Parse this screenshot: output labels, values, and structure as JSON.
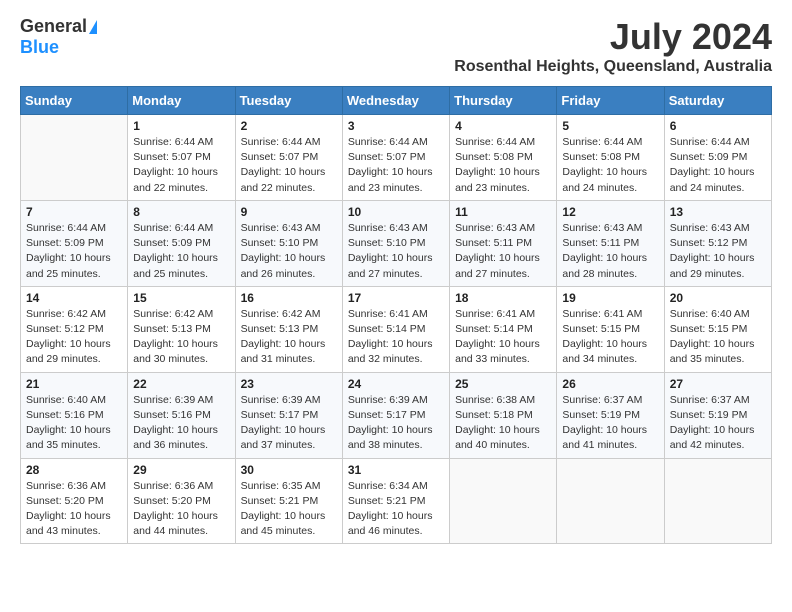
{
  "header": {
    "logo_general": "General",
    "logo_blue": "Blue",
    "month_title": "July 2024",
    "location": "Rosenthal Heights, Queensland, Australia"
  },
  "calendar": {
    "days_of_week": [
      "Sunday",
      "Monday",
      "Tuesday",
      "Wednesday",
      "Thursday",
      "Friday",
      "Saturday"
    ],
    "weeks": [
      [
        {
          "day": "",
          "info": ""
        },
        {
          "day": "1",
          "info": "Sunrise: 6:44 AM\nSunset: 5:07 PM\nDaylight: 10 hours\nand 22 minutes."
        },
        {
          "day": "2",
          "info": "Sunrise: 6:44 AM\nSunset: 5:07 PM\nDaylight: 10 hours\nand 22 minutes."
        },
        {
          "day": "3",
          "info": "Sunrise: 6:44 AM\nSunset: 5:07 PM\nDaylight: 10 hours\nand 23 minutes."
        },
        {
          "day": "4",
          "info": "Sunrise: 6:44 AM\nSunset: 5:08 PM\nDaylight: 10 hours\nand 23 minutes."
        },
        {
          "day": "5",
          "info": "Sunrise: 6:44 AM\nSunset: 5:08 PM\nDaylight: 10 hours\nand 24 minutes."
        },
        {
          "day": "6",
          "info": "Sunrise: 6:44 AM\nSunset: 5:09 PM\nDaylight: 10 hours\nand 24 minutes."
        }
      ],
      [
        {
          "day": "7",
          "info": "Sunrise: 6:44 AM\nSunset: 5:09 PM\nDaylight: 10 hours\nand 25 minutes."
        },
        {
          "day": "8",
          "info": "Sunrise: 6:44 AM\nSunset: 5:09 PM\nDaylight: 10 hours\nand 25 minutes."
        },
        {
          "day": "9",
          "info": "Sunrise: 6:43 AM\nSunset: 5:10 PM\nDaylight: 10 hours\nand 26 minutes."
        },
        {
          "day": "10",
          "info": "Sunrise: 6:43 AM\nSunset: 5:10 PM\nDaylight: 10 hours\nand 27 minutes."
        },
        {
          "day": "11",
          "info": "Sunrise: 6:43 AM\nSunset: 5:11 PM\nDaylight: 10 hours\nand 27 minutes."
        },
        {
          "day": "12",
          "info": "Sunrise: 6:43 AM\nSunset: 5:11 PM\nDaylight: 10 hours\nand 28 minutes."
        },
        {
          "day": "13",
          "info": "Sunrise: 6:43 AM\nSunset: 5:12 PM\nDaylight: 10 hours\nand 29 minutes."
        }
      ],
      [
        {
          "day": "14",
          "info": "Sunrise: 6:42 AM\nSunset: 5:12 PM\nDaylight: 10 hours\nand 29 minutes."
        },
        {
          "day": "15",
          "info": "Sunrise: 6:42 AM\nSunset: 5:13 PM\nDaylight: 10 hours\nand 30 minutes."
        },
        {
          "day": "16",
          "info": "Sunrise: 6:42 AM\nSunset: 5:13 PM\nDaylight: 10 hours\nand 31 minutes."
        },
        {
          "day": "17",
          "info": "Sunrise: 6:41 AM\nSunset: 5:14 PM\nDaylight: 10 hours\nand 32 minutes."
        },
        {
          "day": "18",
          "info": "Sunrise: 6:41 AM\nSunset: 5:14 PM\nDaylight: 10 hours\nand 33 minutes."
        },
        {
          "day": "19",
          "info": "Sunrise: 6:41 AM\nSunset: 5:15 PM\nDaylight: 10 hours\nand 34 minutes."
        },
        {
          "day": "20",
          "info": "Sunrise: 6:40 AM\nSunset: 5:15 PM\nDaylight: 10 hours\nand 35 minutes."
        }
      ],
      [
        {
          "day": "21",
          "info": "Sunrise: 6:40 AM\nSunset: 5:16 PM\nDaylight: 10 hours\nand 35 minutes."
        },
        {
          "day": "22",
          "info": "Sunrise: 6:39 AM\nSunset: 5:16 PM\nDaylight: 10 hours\nand 36 minutes."
        },
        {
          "day": "23",
          "info": "Sunrise: 6:39 AM\nSunset: 5:17 PM\nDaylight: 10 hours\nand 37 minutes."
        },
        {
          "day": "24",
          "info": "Sunrise: 6:39 AM\nSunset: 5:17 PM\nDaylight: 10 hours\nand 38 minutes."
        },
        {
          "day": "25",
          "info": "Sunrise: 6:38 AM\nSunset: 5:18 PM\nDaylight: 10 hours\nand 40 minutes."
        },
        {
          "day": "26",
          "info": "Sunrise: 6:37 AM\nSunset: 5:19 PM\nDaylight: 10 hours\nand 41 minutes."
        },
        {
          "day": "27",
          "info": "Sunrise: 6:37 AM\nSunset: 5:19 PM\nDaylight: 10 hours\nand 42 minutes."
        }
      ],
      [
        {
          "day": "28",
          "info": "Sunrise: 6:36 AM\nSunset: 5:20 PM\nDaylight: 10 hours\nand 43 minutes."
        },
        {
          "day": "29",
          "info": "Sunrise: 6:36 AM\nSunset: 5:20 PM\nDaylight: 10 hours\nand 44 minutes."
        },
        {
          "day": "30",
          "info": "Sunrise: 6:35 AM\nSunset: 5:21 PM\nDaylight: 10 hours\nand 45 minutes."
        },
        {
          "day": "31",
          "info": "Sunrise: 6:34 AM\nSunset: 5:21 PM\nDaylight: 10 hours\nand 46 minutes."
        },
        {
          "day": "",
          "info": ""
        },
        {
          "day": "",
          "info": ""
        },
        {
          "day": "",
          "info": ""
        }
      ]
    ]
  }
}
